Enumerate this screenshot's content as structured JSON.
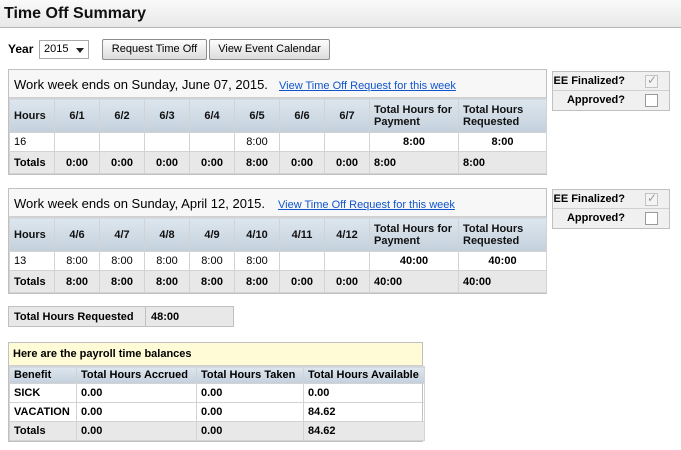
{
  "page_title": "Time Off Summary",
  "toolbar": {
    "year_label": "Year",
    "year_value": "2015",
    "request_button": "Request Time Off",
    "calendar_button": "View Event Calendar"
  },
  "weeks": [
    {
      "title": "Work week ends on Sunday, June 07, 2015.",
      "link": "View Time Off Request for this week",
      "headers": [
        "Hours",
        "6/1",
        "6/2",
        "6/3",
        "6/4",
        "6/5",
        "6/6",
        "6/7",
        "Total Hours for Payment",
        "Total Hours Requested"
      ],
      "row": [
        "16",
        "",
        "",
        "",
        "",
        "8:00",
        "",
        "",
        "8:00",
        "8:00"
      ],
      "totals": [
        "Totals",
        "0:00",
        "0:00",
        "0:00",
        "0:00",
        "8:00",
        "0:00",
        "0:00",
        "8:00",
        "8:00"
      ],
      "ee_finalized_label": "EE Finalized?",
      "approved_label": "Approved?"
    },
    {
      "title": "Work week ends on Sunday, April 12, 2015.",
      "link": "View Time Off Request for this week",
      "headers": [
        "Hours",
        "4/6",
        "4/7",
        "4/8",
        "4/9",
        "4/10",
        "4/11",
        "4/12",
        "Total Hours for Payment",
        "Total Hours Requested"
      ],
      "row": [
        "13",
        "8:00",
        "8:00",
        "8:00",
        "8:00",
        "8:00",
        "",
        "",
        "40:00",
        "40:00"
      ],
      "totals": [
        "Totals",
        "8:00",
        "8:00",
        "8:00",
        "8:00",
        "8:00",
        "0:00",
        "0:00",
        "40:00",
        "40:00"
      ],
      "ee_finalized_label": "EE Finalized?",
      "approved_label": "Approved?"
    }
  ],
  "total_requested": {
    "label": "Total Hours Requested",
    "value": "48:00"
  },
  "balances": {
    "heading": "Here are the payroll time balances",
    "headers": [
      "Benefit",
      "Total Hours Accrued",
      "Total Hours Taken",
      "Total Hours Available"
    ],
    "rows": [
      [
        "SICK",
        "0.00",
        "0.00",
        "0.00"
      ],
      [
        "VACATION",
        "0.00",
        "0.00",
        "84.62"
      ],
      [
        "Totals",
        "0.00",
        "0.00",
        "84.62"
      ]
    ]
  }
}
